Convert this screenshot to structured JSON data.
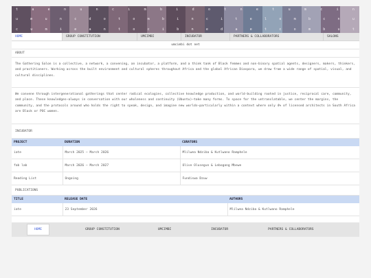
{
  "banner": {
    "row1": [
      "t",
      "a",
      "e",
      "n",
      "u",
      "n",
      "c",
      "i",
      "m",
      "b",
      "i",
      "d",
      "o",
      "t",
      "n",
      "e",
      "t",
      "u",
      "m",
      "c",
      "i",
      "n"
    ],
    "row2": [
      "u",
      "m",
      "u",
      "n",
      "c",
      "d",
      "o",
      "t",
      "o",
      "m",
      "b",
      "i",
      "n",
      "c",
      "i",
      "t",
      "e",
      "l",
      "o",
      "m",
      "b",
      "c",
      "n",
      "u"
    ],
    "row3": [
      "c",
      "u",
      "m",
      "i",
      "e",
      "a",
      "n",
      "t",
      "o",
      "c",
      "i",
      "b",
      "n",
      "e",
      "d",
      "a",
      "e",
      "t",
      "c",
      "o",
      "m",
      "b",
      "u",
      "t"
    ],
    "tile_colors": [
      "#5f5060",
      "#8a6e80",
      "#6d5e70",
      "#9b8896",
      "#5b4f5e",
      "#7f6878",
      "#6a5766",
      "#8c7787",
      "#5d4c5b",
      "#7a6673",
      "#5e5a6e",
      "#8c8aa0",
      "#6f7c95",
      "#92a3b7",
      "#7b7d95",
      "#a2a2b5",
      "#7e6c83",
      "#b5a9b8"
    ]
  },
  "nav": {
    "items": [
      {
        "label": "HOME",
        "active": true
      },
      {
        "label": "GROUP CONSTITUTION",
        "active": false
      },
      {
        "label": "UMCIMBI",
        "active": false
      },
      {
        "label": "INCUBATOR",
        "active": false
      },
      {
        "label": "PARTNERS & COLLABORATORS",
        "active": false
      },
      {
        "label": "SALONS",
        "active": false
      }
    ]
  },
  "subtitle": "umcimbi dot net",
  "about": {
    "heading": "ABOUT",
    "p1": "The Gathering Salon is a collective, a network, a convening, an incubator, a platform, and a think tank of Black femmes and non-binary spatial agents, designers, makers, thinkers, and practitioners. Working across the built environment and cultural spheres throughout Africa and the global African Diaspora, we draw from a wide range of spatial, visual, and cultural disciplines.",
    "p2": "We convene through intergenerational gatherings that center radical ecologies, collective knowledge production, and world-building rooted in justice, reciprocal care, community, and place. These knowledges—always in conversation with our wholeness and continuity (Ubuntu)—take many forms. To space for the untranslatable, we center the margins, the community, and the protocols around who holds the right to speak, design, and imagine new worlds—particularly within a context where only 4% of licensed architects in South Africa are Black or POC women."
  },
  "incubator": {
    "heading": "INCUBATOR",
    "columns": [
      "PROJECT",
      "DURATION",
      "CURATORS"
    ],
    "rows": [
      [
        "iate",
        "March 2025 – March 2026",
        "Mlilwea Ndziba & Kutlwano Ramphele"
      ],
      [
        "fab lab",
        "March 2026 – March 2027",
        "Olive Olusegun & Lebogang Mbewe"
      ],
      [
        "Reading List",
        "Ongoing",
        "Fundiswa Dzuw"
      ]
    ]
  },
  "publications": {
    "heading": "PUBLICATIONS",
    "columns": [
      "TITLE",
      "RELEASE DATE",
      "AUTHORS"
    ],
    "rows": [
      [
        "iate",
        "23 September 2026",
        "Mlilwea Ndziba & Kutlwano Ramphele"
      ]
    ]
  },
  "footer": {
    "items": [
      {
        "label": "HOME",
        "active": true
      },
      {
        "label": "GROUP CONSTITUTION",
        "active": false
      },
      {
        "label": "UMCIMBI",
        "active": false
      },
      {
        "label": "INCUBATOR",
        "active": false
      },
      {
        "label": "PARTNERS & COLLABORATORS",
        "active": false
      }
    ]
  }
}
